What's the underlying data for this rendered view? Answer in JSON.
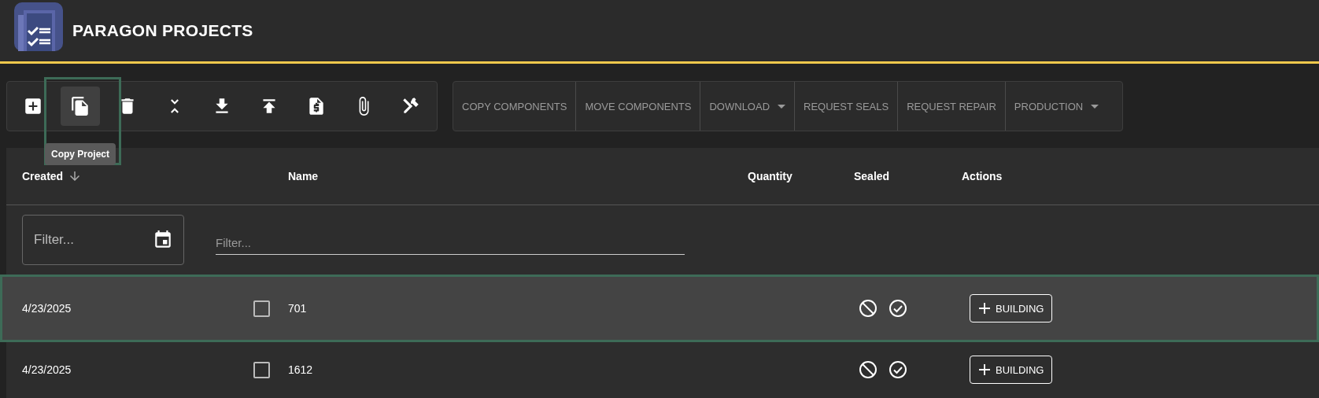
{
  "app": {
    "title": "PARAGON PROJECTS"
  },
  "tools": [
    {
      "kind": "add",
      "hovered": false
    },
    {
      "kind": "copy",
      "hovered": true,
      "tooltip": "Copy Project"
    },
    {
      "kind": "delete",
      "hovered": false
    },
    {
      "kind": "collapse",
      "hovered": false
    },
    {
      "kind": "download",
      "hovered": false
    },
    {
      "kind": "upload",
      "hovered": false
    },
    {
      "kind": "quote",
      "hovered": false
    },
    {
      "kind": "attach",
      "hovered": false
    },
    {
      "kind": "tools",
      "hovered": false
    }
  ],
  "actions": [
    {
      "label": "COPY COMPONENTS",
      "dropdown": false,
      "disabled": true
    },
    {
      "label": "MOVE COMPONENTS",
      "dropdown": false,
      "disabled": true
    },
    {
      "label": "DOWNLOAD",
      "dropdown": true,
      "disabled": true
    },
    {
      "label": "REQUEST SEALS",
      "dropdown": false,
      "disabled": true
    },
    {
      "label": "REQUEST REPAIR",
      "dropdown": false,
      "disabled": true
    },
    {
      "label": "PRODUCTION",
      "dropdown": true,
      "disabled": true
    }
  ],
  "table": {
    "columns": [
      {
        "label": "Created",
        "sorted": true
      },
      {
        "label": "Name",
        "sorted": false
      },
      {
        "label": "Quantity",
        "sorted": false
      },
      {
        "label": "Sealed",
        "sorted": false
      },
      {
        "label": "Actions",
        "sorted": false
      }
    ],
    "filters": {
      "date_placeholder": "Filter...",
      "name_placeholder": "Filter..."
    },
    "rows": [
      {
        "created": "4/23/2025",
        "checked": false,
        "name": "701",
        "selected": true,
        "action": "BUILDING"
      },
      {
        "created": "4/23/2025",
        "checked": false,
        "name": "1612",
        "selected": false,
        "action": "BUILDING"
      }
    ]
  }
}
